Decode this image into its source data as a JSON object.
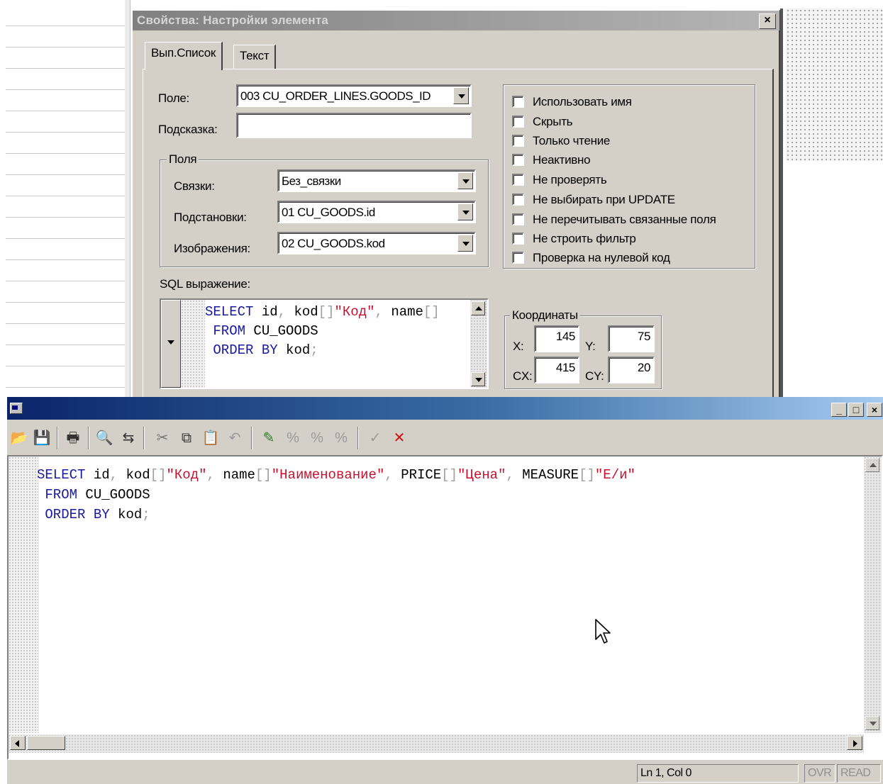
{
  "dialog": {
    "title": "Свойства: Настройки элемента",
    "close": "×",
    "tabs": [
      {
        "label": "Вып.Список",
        "active": true
      },
      {
        "label": "Текст",
        "active": false
      }
    ],
    "field_label": "Поле:",
    "field_value": "003 CU_ORDER_LINES.GOODS_ID",
    "hint_label": "Подсказка:",
    "hint_value": "",
    "fields_group": {
      "title": "Поля",
      "links_label": "Связки:",
      "links_value": "Без_связки",
      "subst_label": "Подстановки:",
      "subst_value": "01 CU_GOODS.id",
      "display_label": "Изображения:",
      "display_value": "02 CU_GOODS.kod"
    },
    "checkboxes": [
      {
        "label": "Использовать имя",
        "checked": false
      },
      {
        "label": "Скрыть",
        "checked": false
      },
      {
        "label": "Только чтение",
        "checked": false
      },
      {
        "label": "Неактивно",
        "checked": false
      },
      {
        "label": "Не проверять",
        "checked": false
      },
      {
        "label": "Не выбирать при UPDATE",
        "checked": false
      },
      {
        "label": "Не перечитывать связанные поля",
        "checked": false
      },
      {
        "label": "Не строить фильтр",
        "checked": false
      },
      {
        "label": "Проверка на нулевой код",
        "checked": false
      }
    ],
    "sql_label": "SQL выражение:",
    "coords": {
      "title": "Координаты",
      "x_label": "X:",
      "x_value": "145",
      "y_label": "Y:",
      "y_value": "75",
      "cx_label": "CX:",
      "cx_value": "415",
      "cy_label": "CY:",
      "cy_value": "20"
    }
  },
  "sql": {
    "l1": {
      "kw1": "SELECT",
      "id": "id",
      "c1": ",",
      "kod": "kod",
      "b1": "[]",
      "s1": "\"Код\"",
      "c2": ",",
      "name": "name",
      "b2": "[]",
      "s2": "\"Наименование\"",
      "c3": ",",
      "price": "PRICE",
      "b3": "[]",
      "s3": "\"Цена\"",
      "c4": ",",
      "measure": "MEASURE",
      "b4": "[]",
      "s4": "\"Е/и\""
    },
    "l2": {
      "kw": "FROM",
      "table": "CU_GOODS"
    },
    "l3": {
      "kw1": "ORDER",
      "kw2": "BY",
      "col": "kod",
      "semi": ";"
    }
  },
  "editor": {
    "controls": {
      "minimize": "_",
      "maximize": "□",
      "close": "×"
    },
    "toolbar": [
      {
        "name": "open-icon",
        "glyph": "📂"
      },
      {
        "name": "save-icon",
        "glyph": "💾"
      },
      {
        "name": "print-icon",
        "glyph": "🖶"
      },
      {
        "name": "find-icon",
        "glyph": "🔍"
      },
      {
        "name": "replace-icon",
        "glyph": "⇆"
      },
      {
        "name": "cut-icon",
        "glyph": "✂"
      },
      {
        "name": "copy-icon",
        "glyph": "⧉"
      },
      {
        "name": "paste-icon",
        "glyph": "📋"
      },
      {
        "name": "undo-icon",
        "glyph": "↶"
      },
      {
        "name": "highlight-icon",
        "glyph": "✎"
      },
      {
        "name": "format-icon-1",
        "glyph": "%"
      },
      {
        "name": "format-icon-2",
        "glyph": "%"
      },
      {
        "name": "format-icon-3",
        "glyph": "%"
      },
      {
        "name": "apply-icon",
        "glyph": "✓"
      },
      {
        "name": "cancel-icon",
        "glyph": "✕"
      }
    ],
    "status": {
      "position": "Ln 1, Col 0",
      "ovr": "OVR",
      "read": "READ"
    }
  },
  "colors": {
    "keyword": "#1a1a9e",
    "string": "#c8102e",
    "punctuation": "#a0a0a0",
    "title_active": "#0a246a",
    "window_face": "#d4d0c8"
  }
}
